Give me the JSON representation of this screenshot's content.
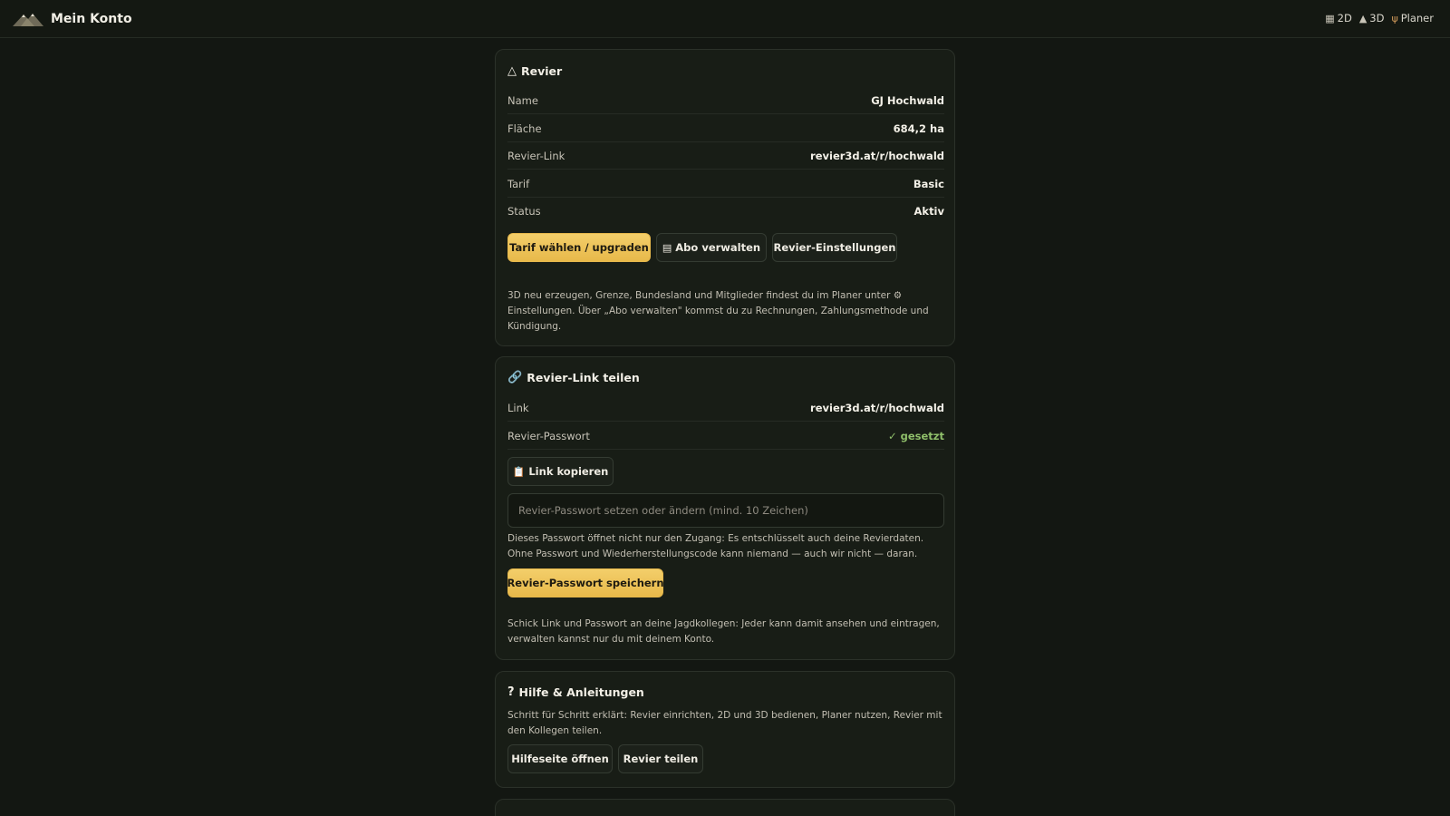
{
  "header": {
    "title": "Mein Konto",
    "nav": [
      {
        "icon": "map-icon",
        "label": "2D"
      },
      {
        "icon": "mountain-icon",
        "label": "3D"
      },
      {
        "icon": "deer-icon",
        "label": "Planer"
      }
    ]
  },
  "revier": {
    "title": "Revier",
    "rows": [
      {
        "label": "Name",
        "value": "GJ Hochwald"
      },
      {
        "label": "Fläche",
        "value": "684,2 ha"
      },
      {
        "label": "Revier-Link",
        "value": "revier3d.at/r/hochwald"
      },
      {
        "label": "Tarif",
        "value": "Basic"
      },
      {
        "label": "Status",
        "value": "Aktiv"
      }
    ],
    "buttons": {
      "upgrade": "Tarif wählen / upgraden",
      "abo": "Abo verwalten",
      "settings": "Revier-Einstellungen"
    },
    "note": "3D neu erzeugen, Grenze, Bundesland und Mitglieder findest du im Planer unter ⚙ Einstellungen. Über „Abo verwalten\" kommst du zu Rechnungen, Zahlungsmethode und Kündigung."
  },
  "share": {
    "title": "Revier-Link teilen",
    "rows": [
      {
        "label": "Link",
        "value": "revier3d.at/r/hochwald"
      },
      {
        "label": "Revier-Passwort",
        "value": "✓ gesetzt"
      }
    ],
    "copy_button": "Link kopieren",
    "password_placeholder": "Revier-Passwort setzen oder ändern (mind. 10 Zeichen)",
    "password_note": "Dieses Passwort öffnet nicht nur den Zugang: Es entschlüsselt auch deine Revierdaten. Ohne Passwort und Wiederherstellungscode kann niemand — auch wir nicht — daran.",
    "save_button": "Revier-Passwort speichern",
    "footer_note": "Schick Link und Passwort an deine Jagdkollegen: Jeder kann damit ansehen und eintragen, verwalten kannst nur du mit deinem Konto."
  },
  "help": {
    "title": "Hilfe & Anleitungen",
    "text": "Schritt für Schritt erklärt: Revier einrichten, 2D und 3D bedienen, Planer nutzen, Revier mit den Kollegen teilen.",
    "open_button": "Hilfeseite öffnen",
    "share_button": "Revier teilen"
  },
  "colors": {
    "background": "#131712",
    "card": "#181d16",
    "accent": "#e8b94a",
    "success": "#8fbf6a"
  }
}
